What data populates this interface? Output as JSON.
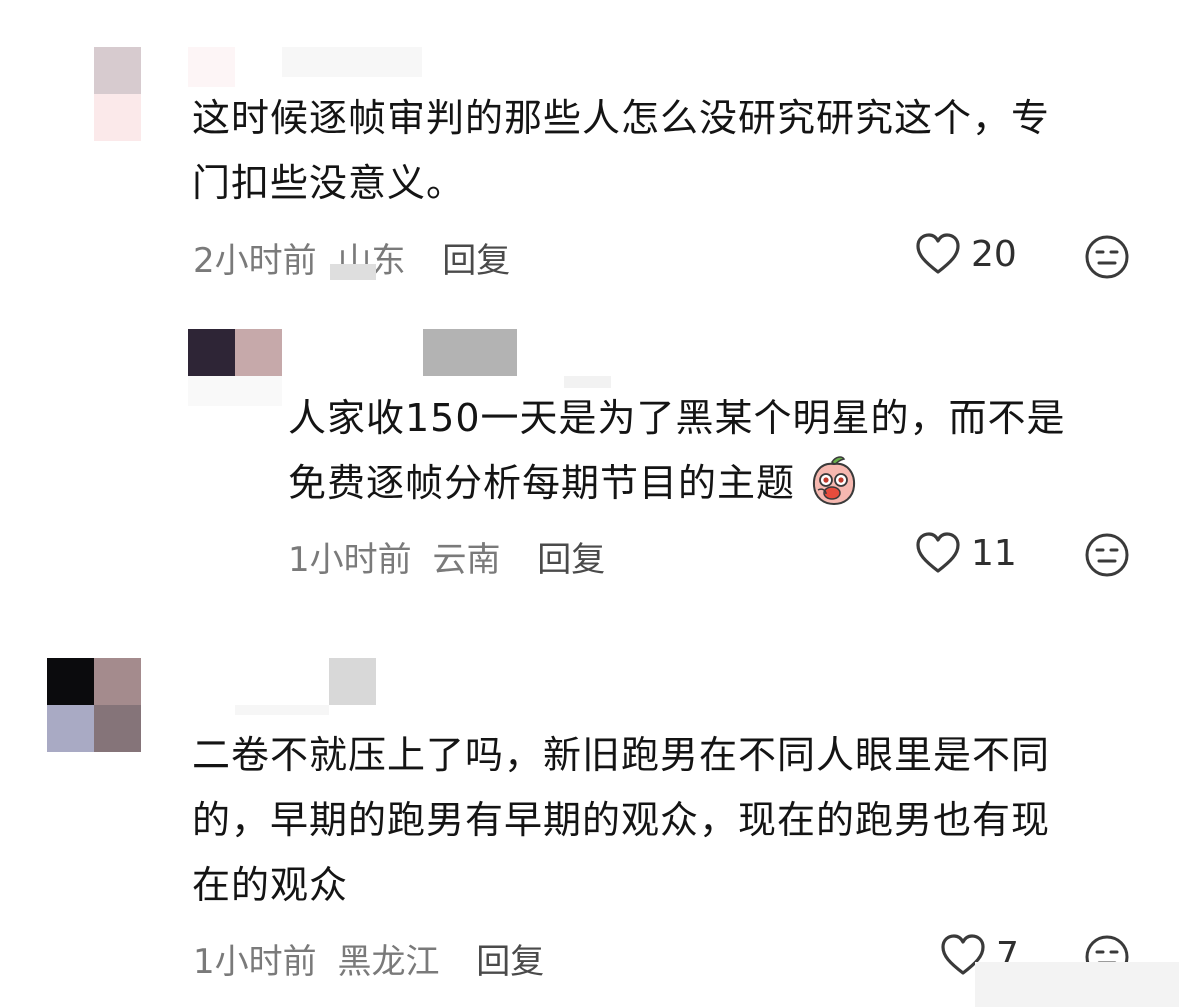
{
  "comments": [
    {
      "text_line1": "这时候逐帧审判的那些人怎么没研究研究这个，专",
      "text_line2": "门扣些没意义。",
      "time": "2小时前",
      "location": "山东",
      "reply_label": "回复",
      "likes": "20",
      "avatar_colors": [
        "#d7cbcf",
        "#ffffff",
        "#fbe9ea",
        "#ffffff"
      ]
    },
    {
      "text_line1": "人家收150一天是为了黑某个明星的，而不是",
      "text_line2": "免费逐帧分析每期节目的主题",
      "time": "1小时前",
      "location": "云南",
      "reply_label": "回复",
      "likes": "11",
      "avatar_colors": [
        "#2e2536",
        "#c6a9aa"
      ]
    },
    {
      "text_line1": "二卷不就压上了吗，新旧跑男在不同人眼里是不同",
      "text_line2": "的，早期的跑男有早期的观众，现在的跑男也有现",
      "text_line3": "在的观众",
      "time": "1小时前",
      "location": "黑龙江",
      "reply_label": "回复",
      "likes": "7",
      "avatar_colors": [
        "#0b0b0d",
        "#a48b8d",
        "#a9aac4",
        "#857479"
      ]
    }
  ],
  "icons": {
    "like": "heart-outline-icon",
    "dislike": "neutral-face-icon",
    "emoji": "peach-emoji-icon"
  }
}
